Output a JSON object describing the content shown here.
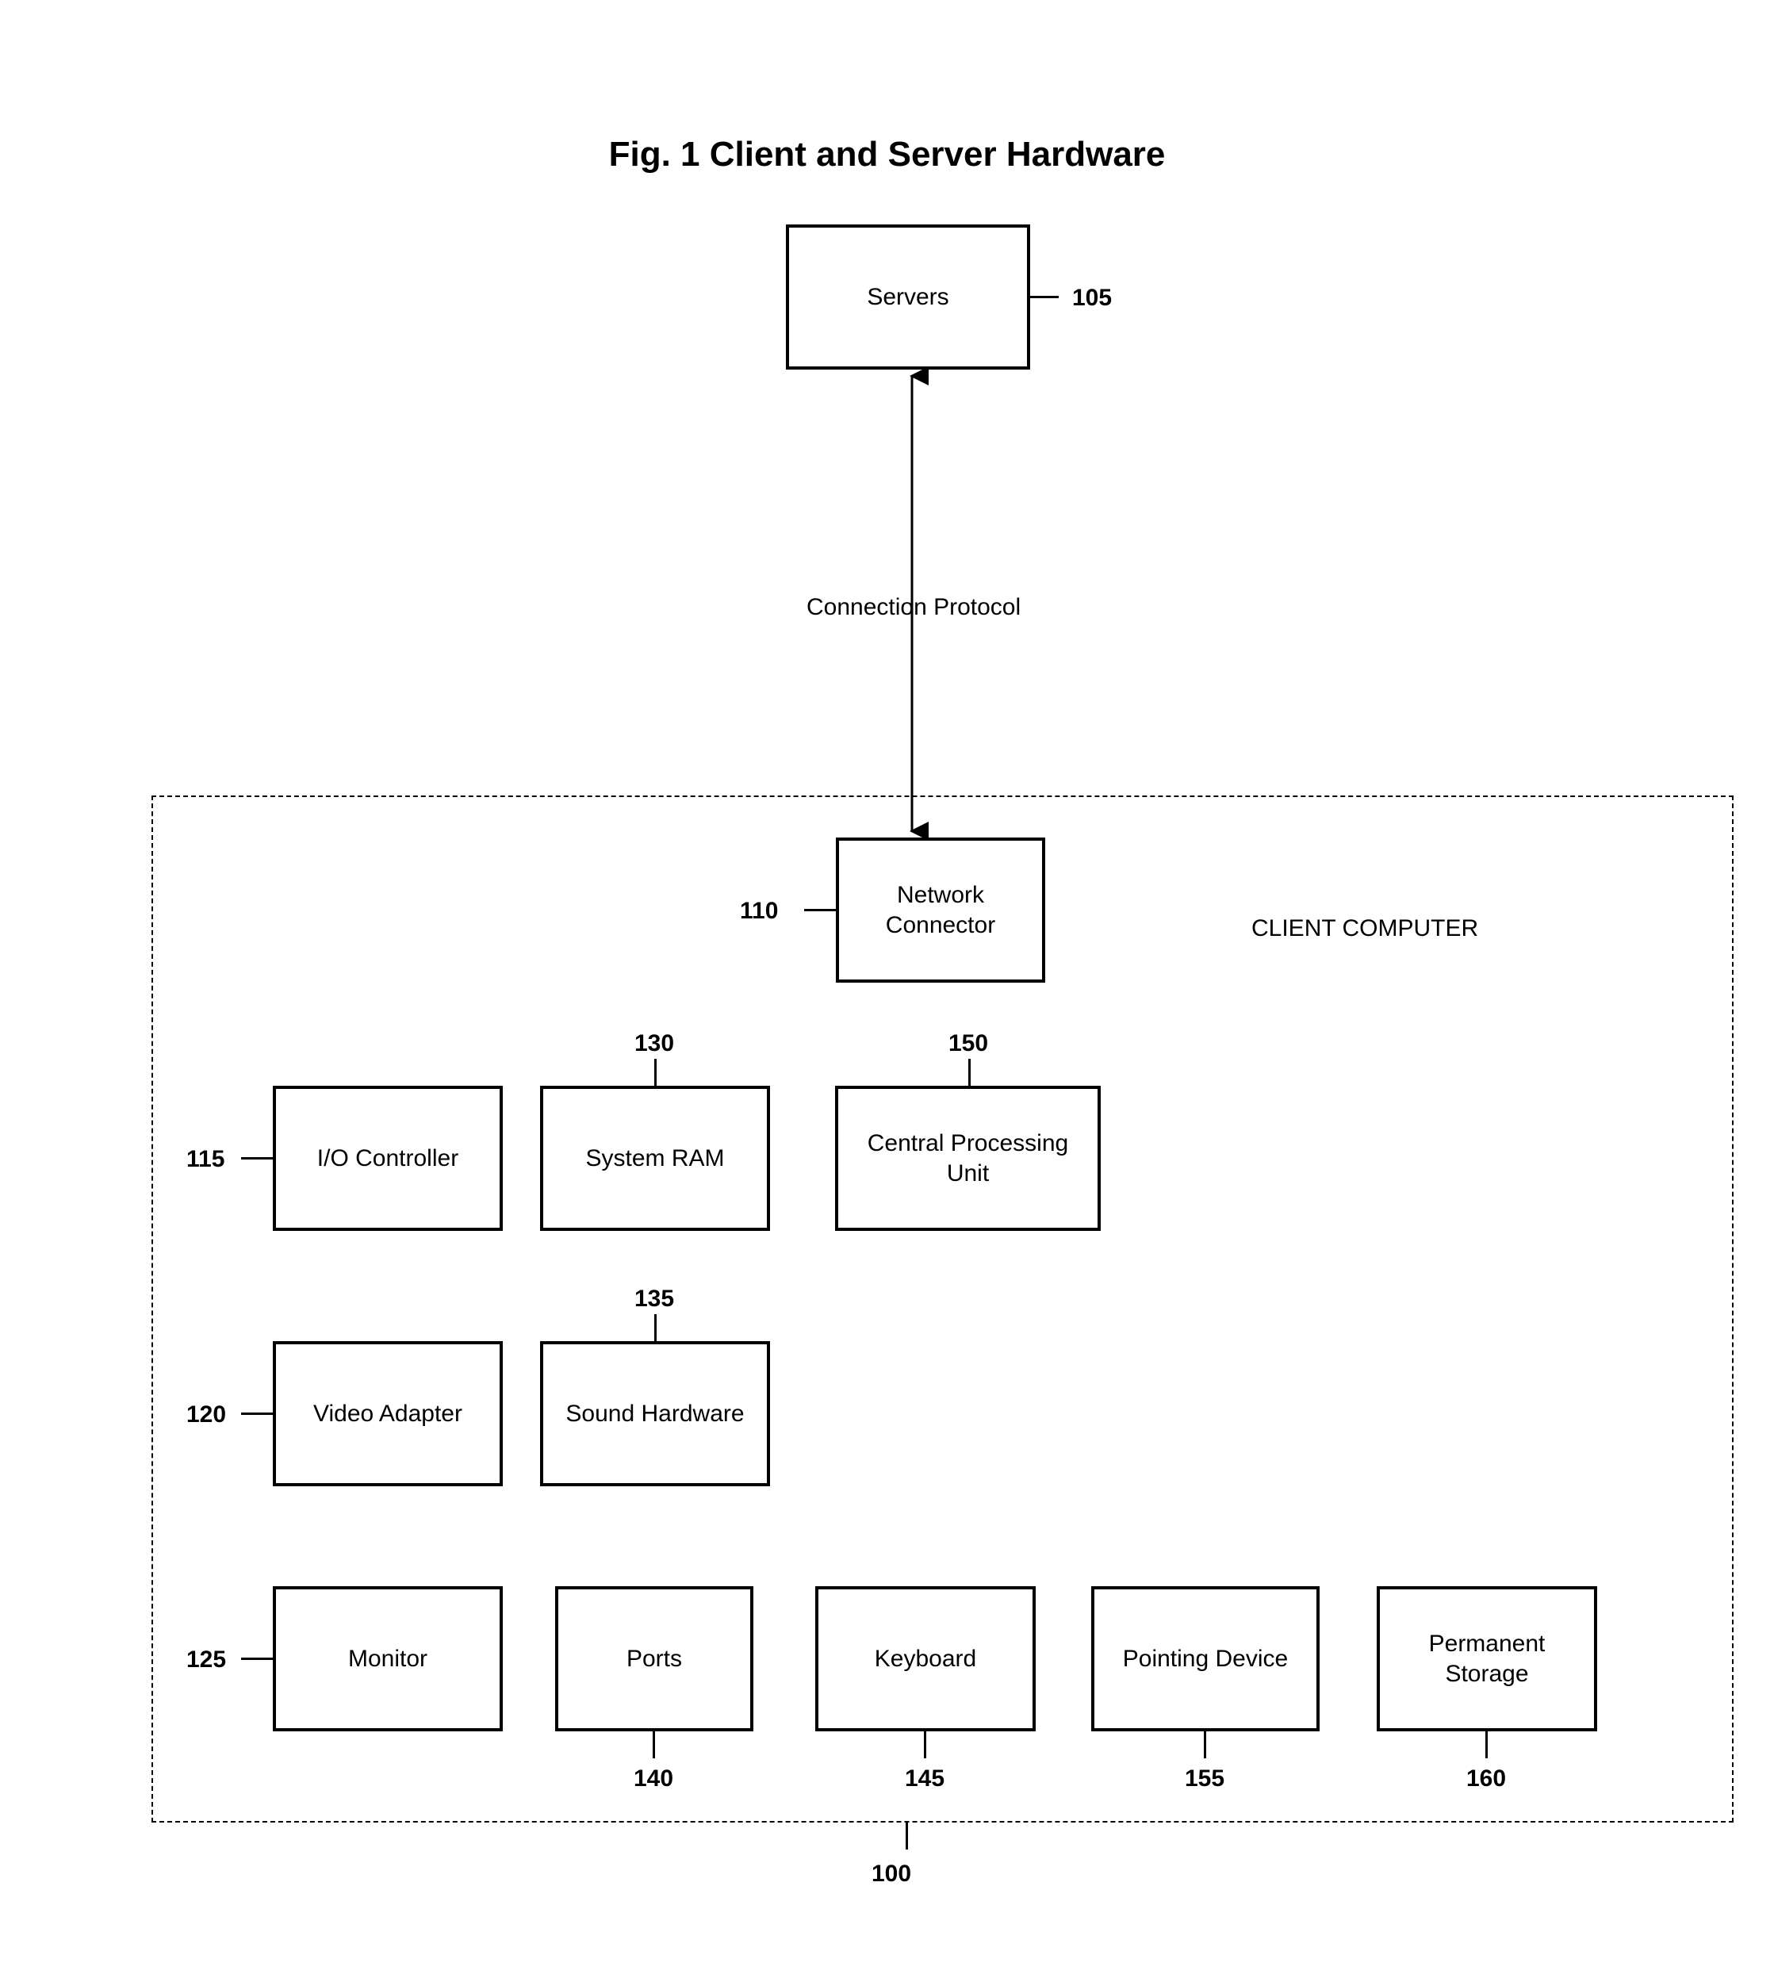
{
  "title": "Fig. 1 Client and Server Hardware",
  "connection_label": "Connection Protocol",
  "client_label": "CLIENT COMPUTER",
  "boxes": {
    "servers": "Servers",
    "network_connector": "Network\nConnector",
    "io_controller": "I/O Controller",
    "system_ram": "System RAM",
    "cpu": "Central Processing\nUnit",
    "video_adapter": "Video Adapter",
    "sound_hw": "Sound Hardware",
    "monitor": "Monitor",
    "ports": "Ports",
    "keyboard": "Keyboard",
    "pointing": "Pointing Device",
    "storage": "Permanent\nStorage"
  },
  "refs": {
    "servers": "105",
    "network_connector": "110",
    "io_controller": "115",
    "video_adapter": "120",
    "monitor": "125",
    "system_ram": "130",
    "sound_hw": "135",
    "ports": "140",
    "keyboard": "145",
    "cpu": "150",
    "pointing": "155",
    "storage": "160",
    "client": "100"
  }
}
